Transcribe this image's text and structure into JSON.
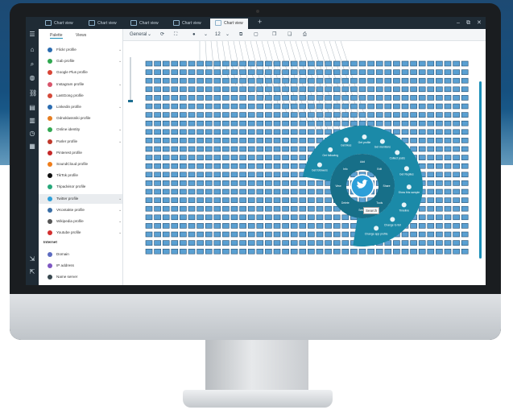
{
  "titlebar": {
    "tabs": [
      "Chart view",
      "Chart view",
      "Chart view",
      "Chart view",
      "Chart view"
    ],
    "active_tab": 4,
    "add_tab": "+",
    "controls": [
      "–",
      "⧉",
      "✕"
    ]
  },
  "panel": {
    "tabs": [
      "Palette",
      "Views"
    ],
    "items": [
      {
        "label": "Flickr profile",
        "color": "#2b6cb0",
        "chev": "⌄"
      },
      {
        "label": "Gab profile",
        "color": "#2fa84f",
        "chev": "⌄"
      },
      {
        "label": "Google Plus profile",
        "color": "#d94436",
        "chev": ""
      },
      {
        "label": "Instagram profile",
        "color": "#d8546b",
        "chev": "⌄"
      },
      {
        "label": "LastGong profile",
        "color": "#d44a3a",
        "chev": ""
      },
      {
        "label": "Linkedin profile",
        "color": "#2b6cb0",
        "chev": "⌄"
      },
      {
        "label": "Odnoklassniki profile",
        "color": "#e67e22",
        "chev": ""
      },
      {
        "label": "Online identity",
        "color": "#33a853",
        "chev": "⌄"
      },
      {
        "label": "Parler profile",
        "color": "#c0392b",
        "chev": "⌄"
      },
      {
        "label": "Pinterest profile",
        "color": "#c62828",
        "chev": ""
      },
      {
        "label": "SoundCloud profile",
        "color": "#ef7d1a",
        "chev": ""
      },
      {
        "label": "TikTok profile",
        "color": "#111111",
        "chev": ""
      },
      {
        "label": "Tripadvisor profile",
        "color": "#27a87a",
        "chev": ""
      },
      {
        "label": "Twitter profile",
        "color": "#2d9fd9",
        "chev": "⌄"
      },
      {
        "label": "VKontakte profile",
        "color": "#3a6ea5",
        "chev": "⌄"
      },
      {
        "label": "Wikipedia profile",
        "color": "#555555",
        "chev": "⌄"
      },
      {
        "label": "Youtube profile",
        "color": "#d32f2f",
        "chev": "⌄"
      }
    ],
    "selected_index": 13,
    "section": "Internet",
    "section_items": [
      {
        "label": "Domain",
        "color": "#5c6bc0"
      },
      {
        "label": "IP address",
        "color": "#7e57c2"
      },
      {
        "label": "Name server",
        "color": "#37474f"
      }
    ]
  },
  "toolbar": {
    "layout": "General",
    "layout_chev": "⌄",
    "refresh": "⟳",
    "fit": "⛶",
    "dot": "●",
    "dot_chev": "⌄",
    "size": "12",
    "size_chev": "⌄",
    "copy": "⧉",
    "paste": "▢",
    "stack1": "❐",
    "stack2": "❏",
    "print": "⎙"
  },
  "radial_menu": {
    "center_color": "#2d9fd9",
    "ring_color": "#1b8aa8",
    "outer_items": [
      "Get followers",
      "Get following",
      "Get likes",
      "Get profile",
      "Get mentions",
      "Collect posts",
      "Get Replies",
      "Show this sample",
      "Timeline",
      "Change to full",
      "Change app profile"
    ],
    "inner_items": [
      "Add",
      "Edit",
      "Share",
      "Tools",
      "Select",
      "Delete",
      "View",
      "Info"
    ],
    "tooltip": "Search"
  }
}
